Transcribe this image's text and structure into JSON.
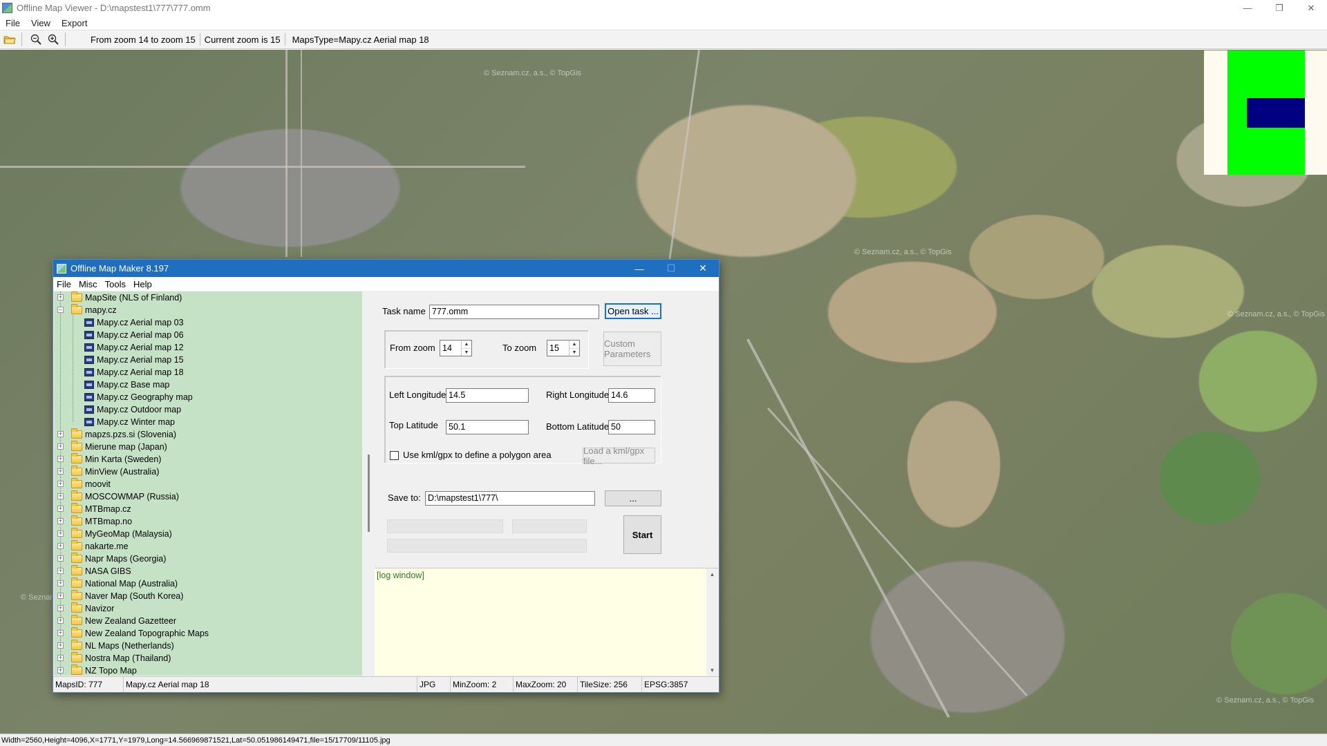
{
  "viewer": {
    "title": "Offline Map Viewer - D:\\mapstest1\\777\\777.omm",
    "menu": [
      "File",
      "View",
      "Export"
    ],
    "toolbar_texts": [
      "From zoom 14 to zoom 15",
      "Current zoom is 15",
      "MapsType=Mapy.cz Aerial map 18"
    ],
    "status": "Width=2560,Height=4096,X=1771,Y=1979,Long=14.566969871521,Lat=50.051986149471,file=15/17709/11105.jpg",
    "watermarks": [
      "© Seznam.cz, a.s., © TopGis",
      "© Seznam.cz, a.s., © TopGis",
      "© Seznam.cz, a.s., © TopGis",
      "© Seznam.cz, a.s., © TopGis",
      "© Seznam.cz, a.s., © TopGis"
    ]
  },
  "dialog": {
    "title": "Offline Map Maker 8.197",
    "menu": [
      "File",
      "Misc",
      "Tools",
      "Help"
    ],
    "tree": [
      {
        "label": "MapSite (NLS of Finland)",
        "type": "folder",
        "expanded": false
      },
      {
        "label": "mapy.cz",
        "type": "folder",
        "expanded": true
      },
      {
        "label": "Mapy.cz Aerial map 03",
        "type": "map"
      },
      {
        "label": "Mapy.cz Aerial map 06",
        "type": "map"
      },
      {
        "label": "Mapy.cz Aerial map 12",
        "type": "map"
      },
      {
        "label": "Mapy.cz Aerial map 15",
        "type": "map"
      },
      {
        "label": "Mapy.cz Aerial map 18",
        "type": "map"
      },
      {
        "label": "Mapy.cz Base map",
        "type": "map"
      },
      {
        "label": "Mapy.cz Geography map",
        "type": "map"
      },
      {
        "label": "Mapy.cz Outdoor map",
        "type": "map"
      },
      {
        "label": "Mapy.cz Winter map",
        "type": "map"
      },
      {
        "label": "mapzs.pzs.si (Slovenia)",
        "type": "folder",
        "expanded": false
      },
      {
        "label": "Mierune map (Japan)",
        "type": "folder",
        "expanded": false
      },
      {
        "label": "Min Karta (Sweden)",
        "type": "folder",
        "expanded": false
      },
      {
        "label": "MinView (Australia)",
        "type": "folder",
        "expanded": false
      },
      {
        "label": "moovit",
        "type": "folder",
        "expanded": false
      },
      {
        "label": "MOSCOWMAP (Russia)",
        "type": "folder",
        "expanded": false
      },
      {
        "label": "MTBmap.cz",
        "type": "folder",
        "expanded": false
      },
      {
        "label": "MTBmap.no",
        "type": "folder",
        "expanded": false
      },
      {
        "label": "MyGeoMap (Malaysia)",
        "type": "folder",
        "expanded": false
      },
      {
        "label": "nakarte.me",
        "type": "folder",
        "expanded": false
      },
      {
        "label": "Napr Maps (Georgia)",
        "type": "folder",
        "expanded": false
      },
      {
        "label": "NASA GIBS",
        "type": "folder",
        "expanded": false
      },
      {
        "label": "National Map (Australia)",
        "type": "folder",
        "expanded": false
      },
      {
        "label": "Naver Map (South Korea)",
        "type": "folder",
        "expanded": false
      },
      {
        "label": "Navizor",
        "type": "folder",
        "expanded": false
      },
      {
        "label": "New Zealand Gazetteer",
        "type": "folder",
        "expanded": false
      },
      {
        "label": "New Zealand Topographic Maps",
        "type": "folder",
        "expanded": false
      },
      {
        "label": "NL Maps (Netherlands)",
        "type": "folder",
        "expanded": false
      },
      {
        "label": "Nostra Map (Thailand)",
        "type": "folder",
        "expanded": false
      },
      {
        "label": "NZ Topo Map",
        "type": "folder",
        "expanded": false
      }
    ],
    "form": {
      "task_name_label": "Task name",
      "task_name_value": "777.omm",
      "open_task_label": "Open task ...",
      "from_zoom_label": "From zoom",
      "from_zoom_value": "14",
      "to_zoom_label": "To zoom",
      "to_zoom_value": "15",
      "custom_params_label": "Custom Parameters",
      "left_lon_label": "Left Longitude",
      "left_lon_value": "14.5",
      "right_lon_label": "Right Longitude",
      "right_lon_value": "14.6",
      "top_lat_label": "Top Latitude",
      "top_lat_value": "50.1",
      "bottom_lat_label": "Bottom Latitude",
      "bottom_lat_value": "50",
      "kml_checkbox_label": "Use kml/gpx to define a polygon area",
      "load_kml_label": "Load a kml/gpx file...",
      "save_to_label": "Save to:",
      "save_to_value": "D:\\mapstest1\\777\\",
      "browse_label": "...",
      "start_label": "Start"
    },
    "log_text": "[log window]",
    "status": {
      "maps_id": "MapsID: 777",
      "map_name": "Mapy.cz Aerial map 18",
      "format": "JPG",
      "min_zoom": "MinZoom: 2",
      "max_zoom": "MaxZoom: 20",
      "tile_size": "TileSize: 256",
      "epsg": "EPSG:3857"
    }
  }
}
